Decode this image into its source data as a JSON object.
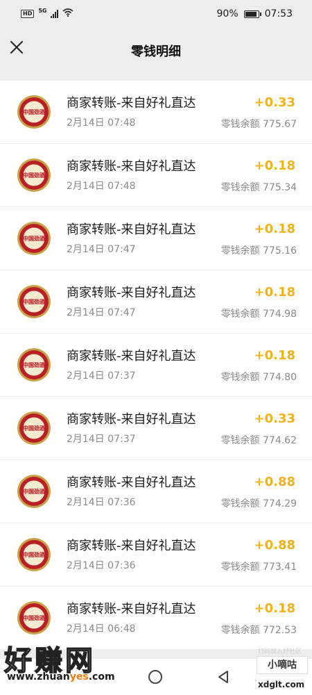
{
  "status_bar": {
    "hd": "HD",
    "network": "5G",
    "wifi_icon": "wifi-icon",
    "battery_percent": "90%",
    "battery_level": 0.9,
    "time": "07:53"
  },
  "navbar": {
    "title": "零钱明细",
    "close_icon": "close-icon"
  },
  "transactions": [
    {
      "title": "商家转账-来自好礼直达",
      "time": "2月14日 07:48",
      "amount": "+0.33",
      "balance": "零钱余额 775.67"
    },
    {
      "title": "商家转账-来自好礼直达",
      "time": "2月14日 07:48",
      "amount": "+0.18",
      "balance": "零钱余额 775.34"
    },
    {
      "title": "商家转账-来自好礼直达",
      "time": "2月14日 07:47",
      "amount": "+0.18",
      "balance": "零钱余额 775.16"
    },
    {
      "title": "商家转账-来自好礼直达",
      "time": "2月14日 07:47",
      "amount": "+0.18",
      "balance": "零钱余额 774.98"
    },
    {
      "title": "商家转账-来自好礼直达",
      "time": "2月14日 07:37",
      "amount": "+0.18",
      "balance": "零钱余额 774.80"
    },
    {
      "title": "商家转账-来自好礼直达",
      "time": "2月14日 07:37",
      "amount": "+0.33",
      "balance": "零钱余额 774.62"
    },
    {
      "title": "商家转账-来自好礼直达",
      "time": "2月14日 07:36",
      "amount": "+0.88",
      "balance": "零钱余额 774.29"
    },
    {
      "title": "商家转账-来自好礼直达",
      "time": "2月14日 07:36",
      "amount": "+0.88",
      "balance": "零钱余额 773.41"
    },
    {
      "title": "商家转账-来自好礼直达",
      "time": "2月14日 06:48",
      "amount": "+0.18",
      "balance": "零钱余额 772.53"
    }
  ],
  "watermarks": {
    "main": "好赚网",
    "url_prefix": "www.zhuan",
    "url_highlight": "yes",
    "url_suffix": ".com",
    "small_text": "扫码加入好社区",
    "side_brand": "小嘀咕",
    "side_url": "xdglt.com"
  },
  "bottom_nav": {
    "home_icon": "circle-home-icon",
    "back_icon": "back-triangle-icon"
  },
  "colors": {
    "amount": "#f2b21a",
    "secondary_text": "#8a8a8a",
    "background": "#ededed"
  }
}
